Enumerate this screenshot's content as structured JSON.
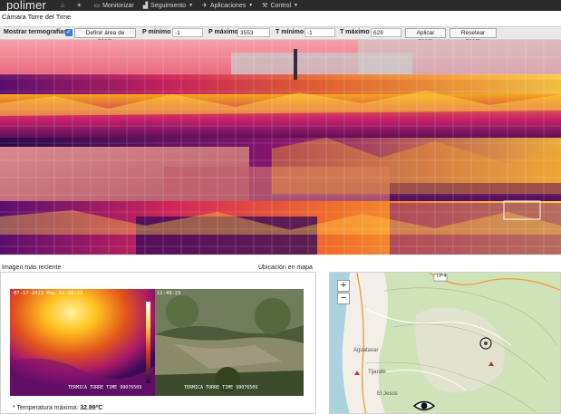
{
  "nav": {
    "brand": "polimer",
    "items": [
      {
        "label": "",
        "icon": "home-icon"
      },
      {
        "label": "",
        "icon": "sun-icon"
      },
      {
        "label": "Monitorizar",
        "icon": "monitor-icon"
      },
      {
        "label": "Seguimiento",
        "icon": "chart-icon"
      },
      {
        "label": "Aplicaciones",
        "icon": "apps-icon"
      },
      {
        "label": "Control",
        "icon": "wrench-icon"
      }
    ]
  },
  "camera_title": "Cámara Torre del Time",
  "toolbar": {
    "show_thermo_label": "Mostrar termografías",
    "show_thermo_checked": true,
    "define_zoom_label": "Definir área de zoom",
    "p_min_label": "P mínimo",
    "p_min_value": "-1",
    "p_max_label": "P máximo",
    "p_max_value": "3553",
    "t_min_label": "T mínimo",
    "t_min_value": "-1",
    "t_max_label": "T máximo",
    "t_max_value": "628",
    "apply_zoom_label": "Aplicar zoom",
    "reset_zoom_label": "Resetear zoom"
  },
  "recent": {
    "title": "Imagen más reciente",
    "thermal_timestamp": "07-17-2023 Mon 11:49:23",
    "thermal_caption": "TERMICA TORRE TIME 99076509",
    "visible_timestamp": "11:49:23",
    "visible_caption": "TERMICA TORRE TIME 99076509",
    "temp_label": "* Temperatura máxima:",
    "temp_value": "32.99ºC"
  },
  "map": {
    "title": "Ubicación en mapa",
    "zoom_in": "+",
    "zoom_out": "−",
    "road_label": "LP-4",
    "places": [
      "Aguatavar",
      "Tijarafe",
      "El Jesús"
    ],
    "colors": {
      "land": "#f2efe9",
      "forest": "#cfe2b8",
      "sea": "#aad3df"
    }
  },
  "colors": {
    "navbar": "#2b2b2b",
    "toolbar": "#e9e9e9",
    "thermal_hot": "#ffd23f",
    "thermal_cold": "#2a0a4a"
  }
}
